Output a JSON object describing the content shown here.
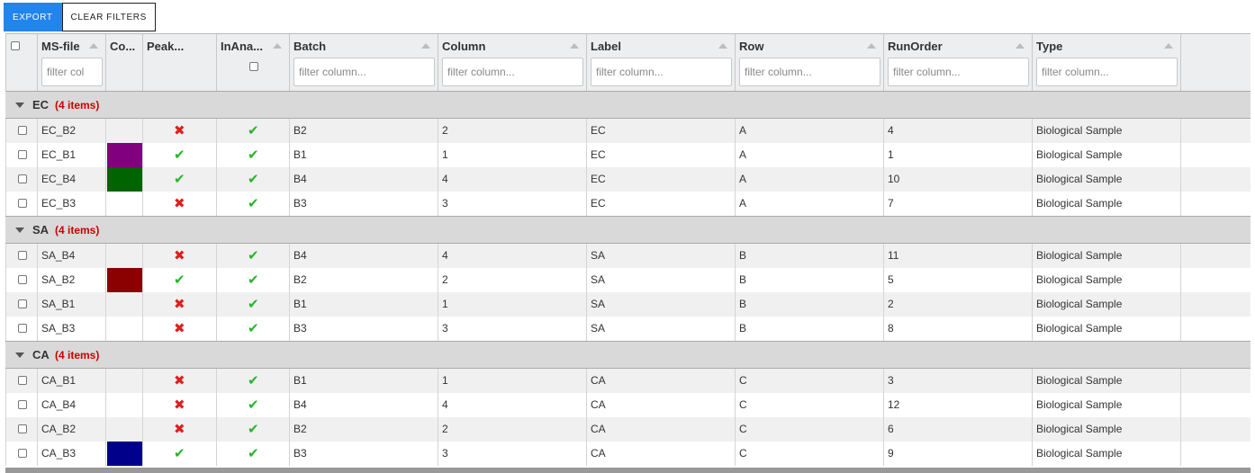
{
  "toolbar": {
    "export_label": "EXPORT",
    "clear_filters_label": "CLEAR FILTERS"
  },
  "columns": [
    {
      "key": "ms_file",
      "title": "MS-file",
      "placeholder": "filter col"
    },
    {
      "key": "color",
      "title": "Co..."
    },
    {
      "key": "peak",
      "title": "Peak..."
    },
    {
      "key": "inana",
      "title": "InAna..."
    },
    {
      "key": "batch",
      "title": "Batch",
      "placeholder": "filter column..."
    },
    {
      "key": "column",
      "title": "Column",
      "placeholder": "filter column..."
    },
    {
      "key": "label",
      "title": "Label",
      "placeholder": "filter column..."
    },
    {
      "key": "row",
      "title": "Row",
      "placeholder": "filter column..."
    },
    {
      "key": "runorder",
      "title": "RunOrder",
      "placeholder": "filter column..."
    },
    {
      "key": "type",
      "title": "Type",
      "placeholder": "filter column..."
    }
  ],
  "icons": {
    "sort": "sort-asc-icon",
    "group_toggle": "caret-down-icon",
    "false_mark": "cross-icon",
    "true_mark": "check-icon"
  },
  "colors": {
    "accent": "#2185f0",
    "cross": "#dd1f1f",
    "check": "#26b526",
    "group_count": "#cc0000"
  },
  "groups": [
    {
      "name": "EC",
      "count_label": "(4 items)",
      "rows": [
        {
          "ms_file": "EC_B2",
          "color": "",
          "peak": false,
          "inana": true,
          "batch": "B2",
          "column": "2",
          "label": "EC",
          "row": "A",
          "runorder": "4",
          "type": "Biological Sample"
        },
        {
          "ms_file": "EC_B1",
          "color": "#800080",
          "peak": true,
          "inana": true,
          "batch": "B1",
          "column": "1",
          "label": "EC",
          "row": "A",
          "runorder": "1",
          "type": "Biological Sample"
        },
        {
          "ms_file": "EC_B4",
          "color": "#006400",
          "peak": true,
          "inana": true,
          "batch": "B4",
          "column": "4",
          "label": "EC",
          "row": "A",
          "runorder": "10",
          "type": "Biological Sample"
        },
        {
          "ms_file": "EC_B3",
          "color": "",
          "peak": false,
          "inana": true,
          "batch": "B3",
          "column": "3",
          "label": "EC",
          "row": "A",
          "runorder": "7",
          "type": "Biological Sample"
        }
      ]
    },
    {
      "name": "SA",
      "count_label": "(4 items)",
      "rows": [
        {
          "ms_file": "SA_B4",
          "color": "",
          "peak": false,
          "inana": true,
          "batch": "B4",
          "column": "4",
          "label": "SA",
          "row": "B",
          "runorder": "11",
          "type": "Biological Sample"
        },
        {
          "ms_file": "SA_B2",
          "color": "#8b0000",
          "peak": true,
          "inana": true,
          "batch": "B2",
          "column": "2",
          "label": "SA",
          "row": "B",
          "runorder": "5",
          "type": "Biological Sample"
        },
        {
          "ms_file": "SA_B1",
          "color": "",
          "peak": false,
          "inana": true,
          "batch": "B1",
          "column": "1",
          "label": "SA",
          "row": "B",
          "runorder": "2",
          "type": "Biological Sample"
        },
        {
          "ms_file": "SA_B3",
          "color": "",
          "peak": false,
          "inana": true,
          "batch": "B3",
          "column": "3",
          "label": "SA",
          "row": "B",
          "runorder": "8",
          "type": "Biological Sample"
        }
      ]
    },
    {
      "name": "CA",
      "count_label": "(4 items)",
      "rows": [
        {
          "ms_file": "CA_B1",
          "color": "",
          "peak": false,
          "inana": true,
          "batch": "B1",
          "column": "1",
          "label": "CA",
          "row": "C",
          "runorder": "3",
          "type": "Biological Sample"
        },
        {
          "ms_file": "CA_B4",
          "color": "",
          "peak": false,
          "inana": true,
          "batch": "B4",
          "column": "4",
          "label": "CA",
          "row": "C",
          "runorder": "12",
          "type": "Biological Sample"
        },
        {
          "ms_file": "CA_B2",
          "color": "",
          "peak": false,
          "inana": true,
          "batch": "B2",
          "column": "2",
          "label": "CA",
          "row": "C",
          "runorder": "6",
          "type": "Biological Sample"
        },
        {
          "ms_file": "CA_B3",
          "color": "#00008b",
          "peak": true,
          "inana": true,
          "batch": "B3",
          "column": "3",
          "label": "CA",
          "row": "C",
          "runorder": "9",
          "type": "Biological Sample"
        }
      ]
    }
  ]
}
